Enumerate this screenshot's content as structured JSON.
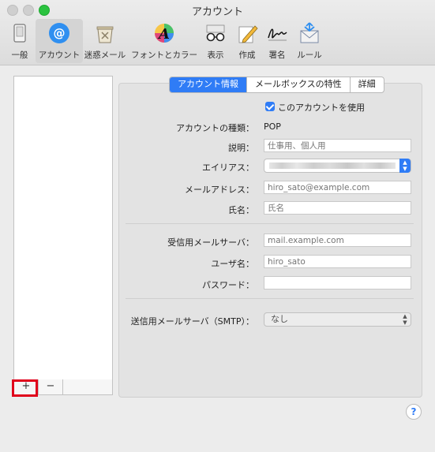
{
  "window": {
    "title": "アカウント"
  },
  "toolbar": {
    "items": [
      {
        "label": "一般",
        "icon": "general-switch-icon"
      },
      {
        "label": "アカウント",
        "icon": "at-sign-icon",
        "selected": true
      },
      {
        "label": "迷惑メール",
        "icon": "junk-trash-icon"
      },
      {
        "label": "フォントとカラー",
        "icon": "font-color-icon"
      },
      {
        "label": "表示",
        "icon": "glasses-icon"
      },
      {
        "label": "作成",
        "icon": "compose-pencil-icon"
      },
      {
        "label": "署名",
        "icon": "signature-icon"
      },
      {
        "label": "ルール",
        "icon": "rules-envelope-icon"
      }
    ]
  },
  "account_list": {
    "add_label": "+",
    "remove_label": "−"
  },
  "tabs": [
    {
      "label": "アカウント情報",
      "active": true
    },
    {
      "label": "メールボックスの特性",
      "active": false
    },
    {
      "label": "詳細",
      "active": false
    }
  ],
  "form": {
    "enable_checkbox": {
      "label": "このアカウントを使用",
      "checked": true
    },
    "account_type": {
      "label": "アカウントの種類：",
      "value": "POP"
    },
    "description": {
      "label": "説明：",
      "placeholder": "仕事用、個人用"
    },
    "alias": {
      "label": "エイリアス："
    },
    "email": {
      "label": "メールアドレス：",
      "placeholder": "hiro_sato@example.com"
    },
    "full_name": {
      "label": "氏名：",
      "placeholder": "氏名"
    },
    "incoming_server": {
      "label": "受信用メールサーバ：",
      "placeholder": "mail.example.com"
    },
    "username": {
      "label": "ユーザ名：",
      "placeholder": "hiro_sato"
    },
    "password": {
      "label": "パスワード：",
      "placeholder": ""
    },
    "smtp": {
      "label": "送信用メールサーバ（SMTP）：",
      "value": "なし"
    }
  },
  "help": {
    "label": "?"
  },
  "colors": {
    "accent": "#2f7cf6",
    "highlight_box": "#e0001b"
  }
}
